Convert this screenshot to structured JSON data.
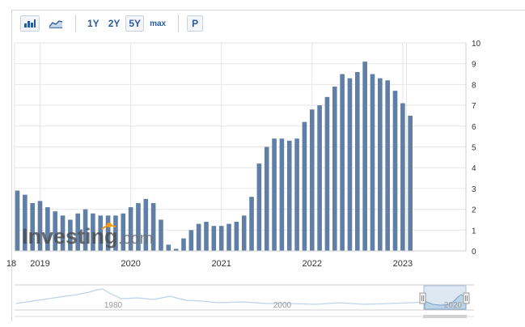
{
  "toolbar": {
    "range_buttons": [
      "1Y",
      "2Y",
      "5Y",
      "max"
    ],
    "active_range": "5Y",
    "p_button": "P"
  },
  "watermark": {
    "brand": "Investing",
    "suffix": ".com"
  },
  "navigator": {
    "labels": [
      "1980",
      "2000",
      "2020"
    ]
  },
  "colors": {
    "bar": "#5f7fa6",
    "grid": "#e6e6e6",
    "navigator_fill": "#bcd3e8"
  },
  "chart_data": {
    "type": "bar",
    "x_tick_labels": [
      "18",
      "2019",
      "2020",
      "2021",
      "2022",
      "2023"
    ],
    "y_ticks": [
      0,
      1,
      2,
      3,
      4,
      5,
      6,
      7,
      8,
      9,
      10
    ],
    "ylim": [
      0,
      10
    ],
    "grid": true,
    "y_axis_position": "right",
    "categories": [
      "2018-10",
      "2018-11",
      "2018-12",
      "2019-01",
      "2019-02",
      "2019-03",
      "2019-04",
      "2019-05",
      "2019-06",
      "2019-07",
      "2019-08",
      "2019-09",
      "2019-10",
      "2019-11",
      "2019-12",
      "2020-01",
      "2020-02",
      "2020-03",
      "2020-04",
      "2020-05",
      "2020-06",
      "2020-07",
      "2020-08",
      "2020-09",
      "2020-10",
      "2020-11",
      "2020-12",
      "2021-01",
      "2021-02",
      "2021-03",
      "2021-04",
      "2021-05",
      "2021-06",
      "2021-07",
      "2021-08",
      "2021-09",
      "2021-10",
      "2021-11",
      "2021-12",
      "2022-01",
      "2022-02",
      "2022-03",
      "2022-04",
      "2022-05",
      "2022-06",
      "2022-07",
      "2022-08",
      "2022-09",
      "2022-10",
      "2022-11",
      "2022-12",
      "2023-01"
    ],
    "values": [
      2.9,
      2.7,
      2.3,
      2.4,
      2.1,
      1.9,
      1.7,
      1.5,
      1.8,
      2.0,
      1.8,
      1.7,
      1.7,
      1.7,
      1.8,
      2.1,
      2.3,
      2.5,
      2.3,
      1.5,
      0.3,
      0.1,
      0.6,
      1.0,
      1.3,
      1.4,
      1.2,
      1.2,
      1.3,
      1.4,
      1.7,
      2.6,
      4.2,
      5.0,
      5.4,
      5.4,
      5.3,
      5.4,
      6.2,
      6.8,
      7.0,
      7.4,
      7.9,
      8.5,
      8.3,
      8.6,
      9.1,
      8.5,
      8.3,
      8.2,
      7.7,
      7.1,
      6.5
    ]
  }
}
